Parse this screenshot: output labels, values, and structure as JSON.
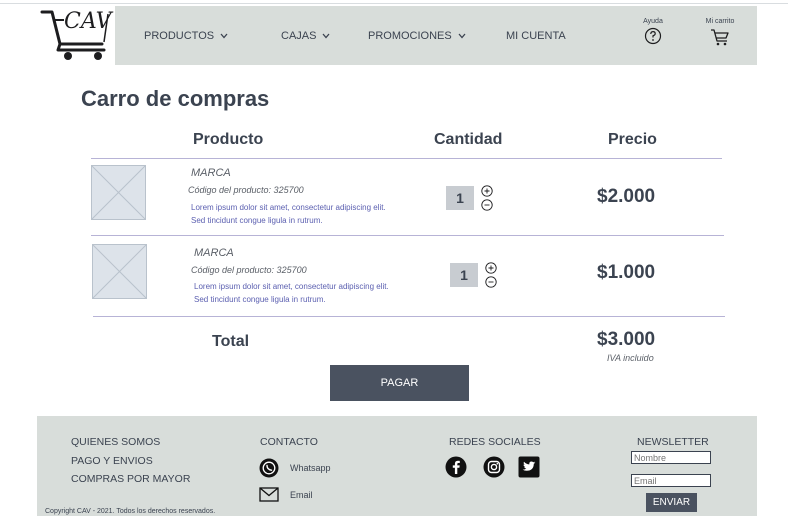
{
  "header": {
    "logo_text": "CAV",
    "nav": [
      {
        "label": "PRODUCTOS",
        "dropdown": true
      },
      {
        "label": "CAJAS",
        "dropdown": true
      },
      {
        "label": "PROMOCIONES",
        "dropdown": true
      },
      {
        "label": "MI CUENTA",
        "dropdown": false
      }
    ],
    "help_label": "Ayuda",
    "cart_label": "Mi carrito"
  },
  "cart": {
    "title": "Carro de compras",
    "columns": {
      "product": "Producto",
      "quantity": "Cantidad",
      "price": "Precio"
    },
    "items": [
      {
        "brand": "MARCA",
        "code": "Código del producto: 325700",
        "description": "Lorem ipsum dolor sit amet, consectetur adipiscing elit. Sed tincidunt congue ligula in rutrum.",
        "quantity": "1",
        "price": "$2.000"
      },
      {
        "brand": "MARCA",
        "code": "Código del producto: 325700",
        "description": "Lorem ipsum dolor sit amet, consectetur adipiscing elit. Sed tincidunt congue ligula in rutrum.",
        "quantity": "1",
        "price": "$1.000"
      }
    ],
    "total_label": "Total",
    "total_value": "$3.000",
    "tax_note": "IVA incluido",
    "pay_button": "PAGAR"
  },
  "footer": {
    "links": [
      "QUIENES SOMOS",
      "PAGO Y ENVIOS",
      "COMPRAS POR MAYOR"
    ],
    "contact_title": "CONTACTO",
    "contact": {
      "whatsapp": "Whatsapp",
      "email": "Email"
    },
    "social_title": "REDES SOCIALES",
    "social_icons": [
      "facebook-icon",
      "instagram-icon",
      "twitter-icon"
    ],
    "newsletter_title": "NEWSLETTER",
    "newsletter_name_placeholder": "Nombre",
    "newsletter_email_placeholder": "Email",
    "newsletter_button": "ENVIAR",
    "copyright": "Copyright CAV - 2021. Todos los derechos reservados."
  },
  "colors": {
    "header_bg": "#d8ddda",
    "text": "#3b4350",
    "button_bg": "#4a5260",
    "divider": "#b7b3d6",
    "description_text": "#5b5fb0"
  }
}
